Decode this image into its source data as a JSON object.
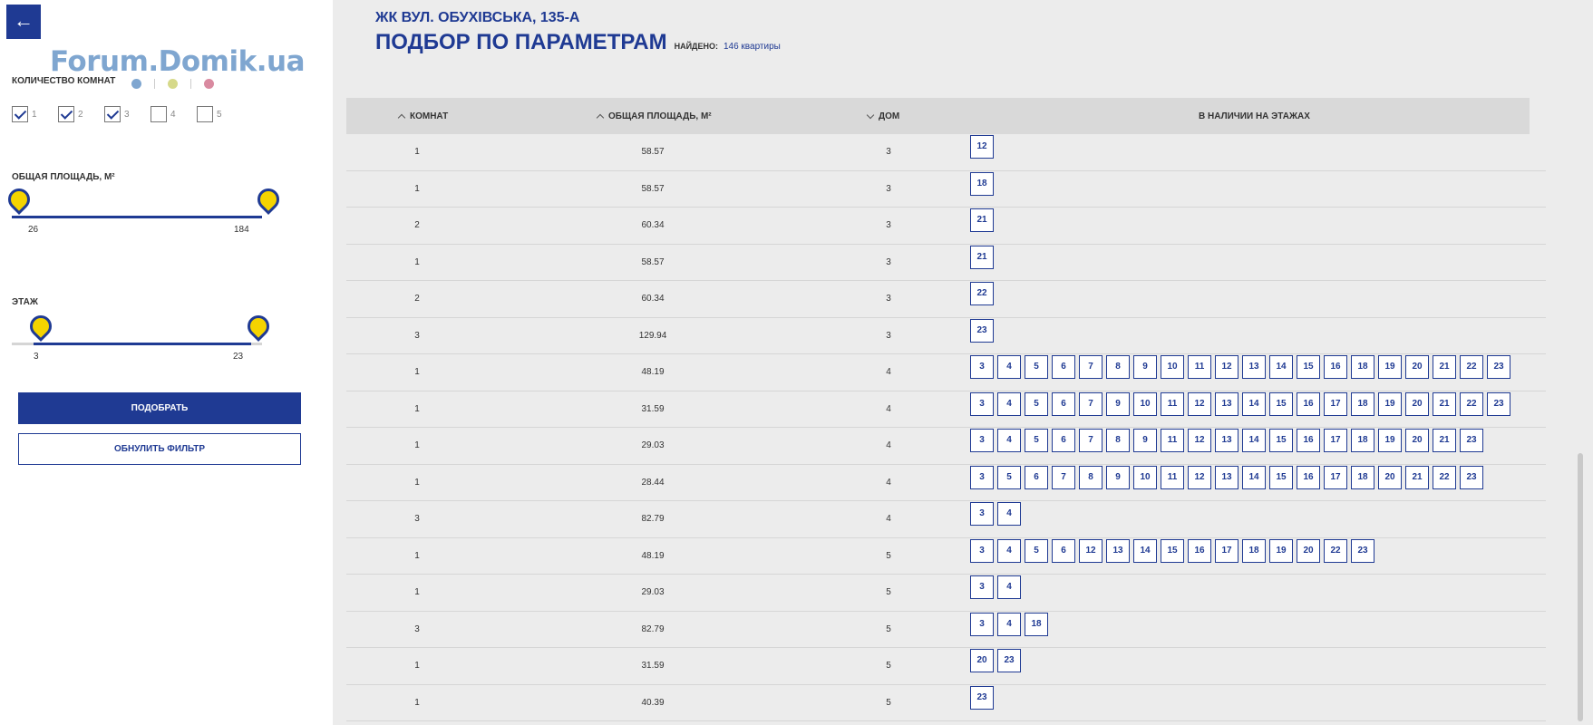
{
  "sidebar": {
    "back_icon": "arrow-left-icon",
    "back_glyph": "←",
    "watermark": "Forum.Domik.ua",
    "rooms_label": "КОЛИЧЕСТВО КОМНАТ",
    "room_colors": [
      "#7fa6d0",
      "#d6d98a",
      "#d98aa0"
    ],
    "room_options": [
      {
        "label": "1",
        "checked": true
      },
      {
        "label": "2",
        "checked": true
      },
      {
        "label": "3",
        "checked": true
      },
      {
        "label": "4",
        "checked": false
      },
      {
        "label": "5",
        "checked": false
      }
    ],
    "area_label": "ОБЩАЯ ПЛОЩАДЬ, М²",
    "area_min": "26",
    "area_max": "184",
    "floor_label": "ЭТАЖ",
    "floor_min": "3",
    "floor_max": "23",
    "apply_button": "ПОДОБРАТЬ",
    "reset_button": "ОБНУЛИТЬ ФИЛЬТР"
  },
  "header": {
    "complex": "ЖК ВУЛ. ОБУХІВСЬКА, 135-А",
    "title": "ПОДБОР ПО ПАРАМЕТРАМ",
    "found_label": "НАЙДЕНО:",
    "found_count": "146 квартиры"
  },
  "table": {
    "columns": [
      "КОМНАТ",
      "ОБЩАЯ ПЛОЩАДЬ, М²",
      "ДОМ",
      "В НАЛИЧИИ НА ЭТАЖАХ"
    ],
    "rows": [
      {
        "rooms": "1",
        "area": "58.57",
        "house": "3",
        "floors": [
          "12"
        ]
      },
      {
        "rooms": "1",
        "area": "58.57",
        "house": "3",
        "floors": [
          "18"
        ]
      },
      {
        "rooms": "2",
        "area": "60.34",
        "house": "3",
        "floors": [
          "21"
        ]
      },
      {
        "rooms": "1",
        "area": "58.57",
        "house": "3",
        "floors": [
          "21"
        ]
      },
      {
        "rooms": "2",
        "area": "60.34",
        "house": "3",
        "floors": [
          "22"
        ]
      },
      {
        "rooms": "3",
        "area": "129.94",
        "house": "3",
        "floors": [
          "23"
        ]
      },
      {
        "rooms": "1",
        "area": "48.19",
        "house": "4",
        "floors": [
          "3",
          "4",
          "5",
          "6",
          "7",
          "8",
          "9",
          "10",
          "11",
          "12",
          "13",
          "14",
          "15",
          "16",
          "18",
          "19",
          "20",
          "21",
          "22",
          "23"
        ]
      },
      {
        "rooms": "1",
        "area": "31.59",
        "house": "4",
        "floors": [
          "3",
          "4",
          "5",
          "6",
          "7",
          "9",
          "10",
          "11",
          "12",
          "13",
          "14",
          "15",
          "16",
          "17",
          "18",
          "19",
          "20",
          "21",
          "22",
          "23"
        ]
      },
      {
        "rooms": "1",
        "area": "29.03",
        "house": "4",
        "floors": [
          "3",
          "4",
          "5",
          "6",
          "7",
          "8",
          "9",
          "11",
          "12",
          "13",
          "14",
          "15",
          "16",
          "17",
          "18",
          "19",
          "20",
          "21",
          "23"
        ]
      },
      {
        "rooms": "1",
        "area": "28.44",
        "house": "4",
        "floors": [
          "3",
          "5",
          "6",
          "7",
          "8",
          "9",
          "10",
          "11",
          "12",
          "13",
          "14",
          "15",
          "16",
          "17",
          "18",
          "20",
          "21",
          "22",
          "23"
        ]
      },
      {
        "rooms": "3",
        "area": "82.79",
        "house": "4",
        "floors": [
          "3",
          "4"
        ]
      },
      {
        "rooms": "1",
        "area": "48.19",
        "house": "5",
        "floors": [
          "3",
          "4",
          "5",
          "6",
          "12",
          "13",
          "14",
          "15",
          "16",
          "17",
          "18",
          "19",
          "20",
          "22",
          "23"
        ]
      },
      {
        "rooms": "1",
        "area": "29.03",
        "house": "5",
        "floors": [
          "3",
          "4"
        ]
      },
      {
        "rooms": "3",
        "area": "82.79",
        "house": "5",
        "floors": [
          "3",
          "4",
          "18"
        ]
      },
      {
        "rooms": "1",
        "area": "31.59",
        "house": "5",
        "floors": [
          "20",
          "23"
        ]
      },
      {
        "rooms": "1",
        "area": "40.39",
        "house": "5",
        "floors": [
          "23"
        ]
      }
    ]
  }
}
